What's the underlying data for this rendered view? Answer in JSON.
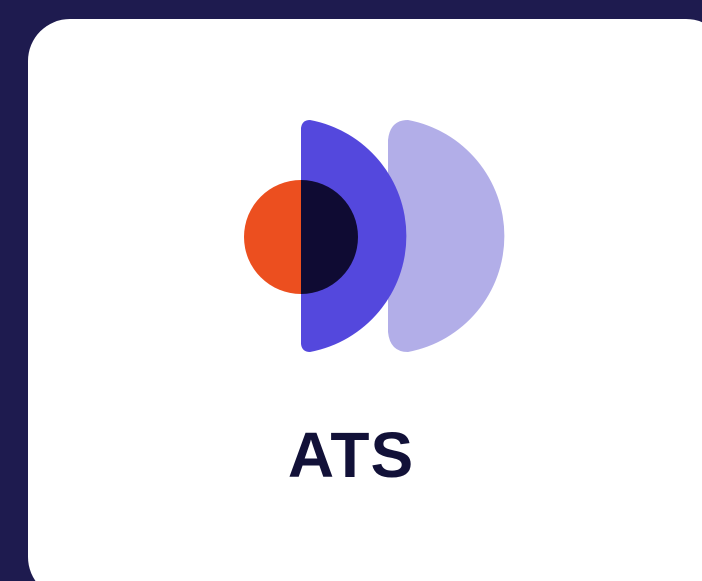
{
  "app_tile": {
    "label": "ATS",
    "icon": "ats-logo-icon",
    "colors": {
      "background": "#1e1b4f",
      "tile": "#ffffff",
      "text": "#121138",
      "orange": "#ec4f1f",
      "dark_navy": "#0f0b33",
      "indigo": "#5448dd",
      "lavender": "#b2aee8"
    }
  }
}
